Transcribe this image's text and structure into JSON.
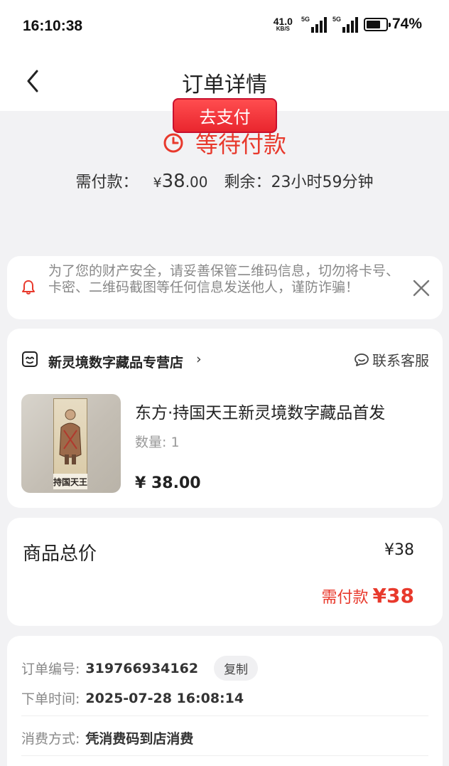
{
  "status_bar": {
    "time": "16:10:38",
    "net_speed_value": "41.0",
    "net_speed_unit": "KB/S",
    "sim1_tag": "5G",
    "sim2_tag": "5G",
    "battery_percent": "74%",
    "battery_level": 0.74
  },
  "nav": {
    "title": "订单详情"
  },
  "order_status": {
    "text": "等待付款",
    "pay_label": "需付款：",
    "currency": "¥",
    "amount_int": "38",
    "amount_dec": ".00",
    "remaining_label": "剩余：",
    "remaining_value": "23小时59分钟",
    "pay_button": "去支付"
  },
  "notice": {
    "text": "为了您的财产安全，请妥善保管二维码信息，切勿将卡号、卡密、二维码截图等任何信息发送他人，谨防诈骗！"
  },
  "shop": {
    "name": "新灵境数字藏品专营店",
    "chevron": "›",
    "service_label": "联系客服"
  },
  "product": {
    "title": "东方·持国天王新灵境数字藏品首发",
    "quantity": "数量: 1",
    "price": "¥ 38.00",
    "image_caption": "持国天王"
  },
  "totals": {
    "label": "商品总价",
    "value": "¥38",
    "need_pay_label": "需付款",
    "need_pay_value": "¥38"
  },
  "order_info": {
    "number_label": "订单编号:",
    "number_value": "319766934162",
    "copy_button": "复制",
    "time_label": "下单时间:",
    "time_value": "2025-07-28 16:08:14",
    "method_label": "消费方式:",
    "method_value": "凭消费码到店消费"
  },
  "colors": {
    "accent": "#e8392c",
    "button": "#ff4d4f",
    "background": "#f2f2f4"
  }
}
